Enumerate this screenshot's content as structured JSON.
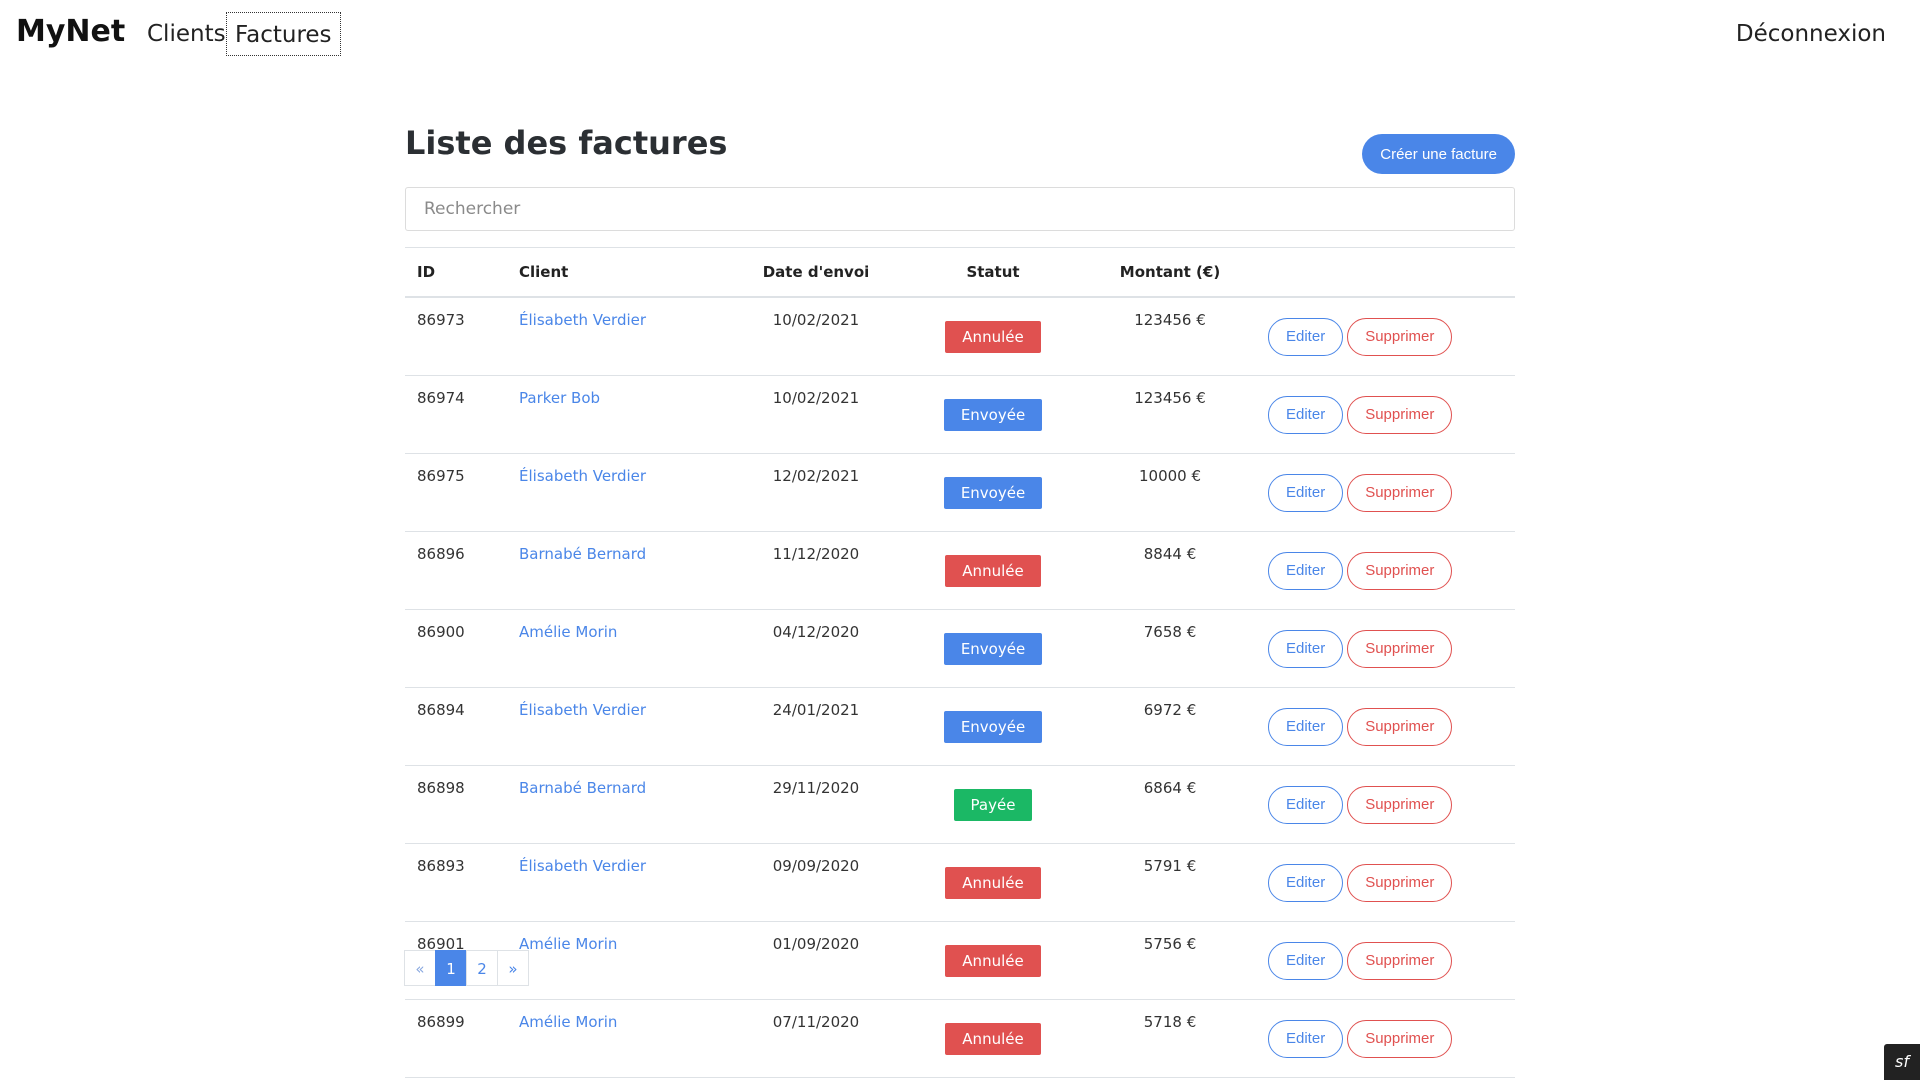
{
  "navbar": {
    "brand": "MyNet",
    "links": [
      "Clients",
      "Factures"
    ],
    "logout": "Déconnexion"
  },
  "page": {
    "title": "Liste des factures",
    "create_button": "Créer une facture",
    "search_placeholder": "Rechercher"
  },
  "table": {
    "headers": [
      "ID",
      "Client",
      "Date d'envoi",
      "Statut",
      "Montant (€)",
      ""
    ],
    "edit_label": "Editer",
    "delete_label": "Supprimer",
    "rows": [
      {
        "id": "86973",
        "client": "Élisabeth Verdier",
        "date": "10/02/2021",
        "status": "Annulée",
        "amount": "123456 €"
      },
      {
        "id": "86974",
        "client": "Parker Bob",
        "date": "10/02/2021",
        "status": "Envoyée",
        "amount": "123456 €"
      },
      {
        "id": "86975",
        "client": "Élisabeth Verdier",
        "date": "12/02/2021",
        "status": "Envoyée",
        "amount": "10000 €"
      },
      {
        "id": "86896",
        "client": "Barnabé Bernard",
        "date": "11/12/2020",
        "status": "Annulée",
        "amount": "8844 €"
      },
      {
        "id": "86900",
        "client": "Amélie Morin",
        "date": "04/12/2020",
        "status": "Envoyée",
        "amount": "7658 €"
      },
      {
        "id": "86894",
        "client": "Élisabeth Verdier",
        "date": "24/01/2021",
        "status": "Envoyée",
        "amount": "6972 €"
      },
      {
        "id": "86898",
        "client": "Barnabé Bernard",
        "date": "29/11/2020",
        "status": "Payée",
        "amount": "6864 €"
      },
      {
        "id": "86893",
        "client": "Élisabeth Verdier",
        "date": "09/09/2020",
        "status": "Annulée",
        "amount": "5791 €"
      },
      {
        "id": "86901",
        "client": "Amélie Morin",
        "date": "01/09/2020",
        "status": "Annulée",
        "amount": "5756 €"
      },
      {
        "id": "86899",
        "client": "Amélie Morin",
        "date": "07/11/2020",
        "status": "Annulée",
        "amount": "5718 €"
      }
    ]
  },
  "pagination": {
    "prev": "«",
    "pages": [
      "1",
      "2"
    ],
    "active": "1",
    "next": "»"
  },
  "colors": {
    "primary": "#4a86e8",
    "danger": "#e05150",
    "success": "#1bb865"
  },
  "debug_toolbar": {
    "icon": "symfony-icon",
    "label": "sf"
  }
}
